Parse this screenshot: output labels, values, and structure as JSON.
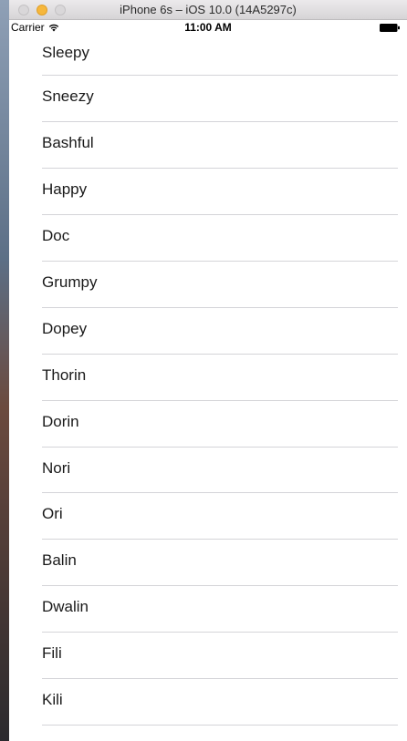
{
  "window": {
    "title": "iPhone 6s – iOS 10.0 (14A5297c)"
  },
  "status_bar": {
    "carrier": "Carrier",
    "time": "11:00 AM",
    "wifi_icon": "wifi-icon",
    "battery_icon": "battery-full-icon"
  },
  "table": {
    "rows": [
      {
        "label": "Sleepy"
      },
      {
        "label": "Sneezy"
      },
      {
        "label": "Bashful"
      },
      {
        "label": "Happy"
      },
      {
        "label": "Doc"
      },
      {
        "label": "Grumpy"
      },
      {
        "label": "Dopey"
      },
      {
        "label": "Thorin"
      },
      {
        "label": "Dorin"
      },
      {
        "label": "Nori"
      },
      {
        "label": "Ori"
      },
      {
        "label": "Balin"
      },
      {
        "label": "Dwalin"
      },
      {
        "label": "Fili"
      },
      {
        "label": "Kili"
      }
    ]
  }
}
